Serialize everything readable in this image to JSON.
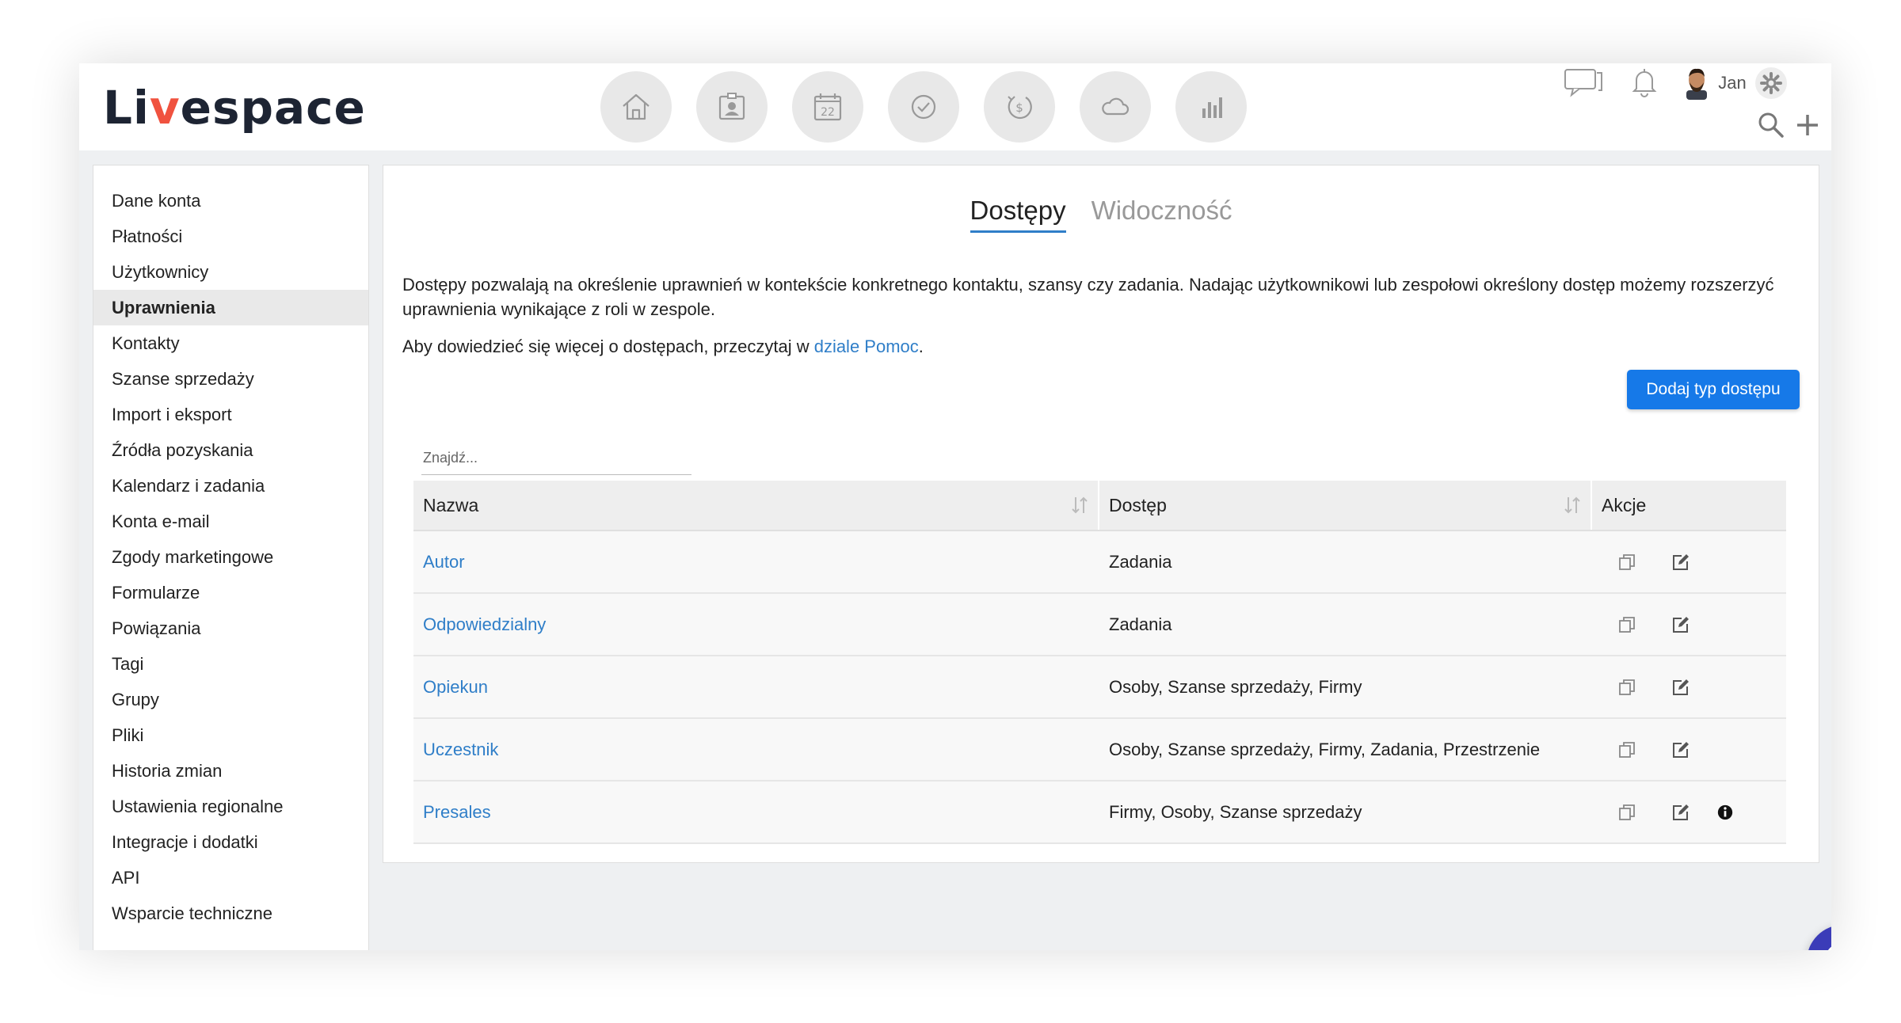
{
  "app": {
    "logo_text_pre": "Li",
    "logo_text_accent": "v",
    "logo_text_post": "espace"
  },
  "nav_icons": [
    "home-icon",
    "contacts-icon",
    "calendar-icon",
    "tasks-icon",
    "deals-icon",
    "cloud-icon",
    "reports-icon"
  ],
  "calendar_day": "22",
  "user": {
    "name": "Jan"
  },
  "sidebar": {
    "items": [
      {
        "label": "Dane konta"
      },
      {
        "label": "Płatności"
      },
      {
        "label": "Użytkownicy"
      },
      {
        "label": "Uprawnienia",
        "active": true
      },
      {
        "label": "Kontakty"
      },
      {
        "label": "Szanse sprzedaży"
      },
      {
        "label": "Import i eksport"
      },
      {
        "label": "Źródła pozyskania"
      },
      {
        "label": "Kalendarz i zadania"
      },
      {
        "label": "Konta e-mail"
      },
      {
        "label": "Zgody marketingowe"
      },
      {
        "label": "Formularze"
      },
      {
        "label": "Powiązania"
      },
      {
        "label": "Tagi"
      },
      {
        "label": "Grupy"
      },
      {
        "label": "Pliki"
      },
      {
        "label": "Historia zmian"
      },
      {
        "label": "Ustawienia regionalne"
      },
      {
        "label": "Integracje i dodatki"
      },
      {
        "label": "API"
      },
      {
        "label": "Wsparcie techniczne"
      }
    ]
  },
  "main": {
    "tabs": [
      {
        "label": "Dostępy",
        "active": true
      },
      {
        "label": "Widoczność",
        "active": false
      }
    ],
    "description": "Dostępy pozwalają na określenie uprawnień w kontekście konkretnego kontaktu, szansy czy zadania. Nadając użytkownikowi lub zespołowi określony dostęp możemy rozszerzyć uprawnienia wynikające z roli w zespole.",
    "help_prefix": "Aby dowiedzieć się więcej o dostępach, przeczytaj w ",
    "help_link": "dziale Pomoc",
    "help_suffix": ".",
    "add_button": "Dodaj typ dostępu",
    "search_placeholder": "Znajdź...",
    "table": {
      "headers": {
        "name": "Nazwa",
        "access": "Dostęp",
        "actions": "Akcje"
      },
      "rows": [
        {
          "name": "Autor",
          "access": "Zadania",
          "info": false
        },
        {
          "name": "Odpowiedzialny",
          "access": "Zadania",
          "info": false
        },
        {
          "name": "Opiekun",
          "access": "Osoby, Szanse sprzedaży, Firmy",
          "info": false
        },
        {
          "name": "Uczestnik",
          "access": "Osoby, Szanse sprzedaży, Firmy, Zadania, Przestrzenie",
          "info": false
        },
        {
          "name": "Presales",
          "access": "Firmy, Osoby, Szanse sprzedaży",
          "info": true
        }
      ]
    }
  },
  "colors": {
    "accent": "#1679e8",
    "link": "#2f7ec8",
    "fab": "#3b3cb8",
    "logo_accent": "#f0523f"
  }
}
